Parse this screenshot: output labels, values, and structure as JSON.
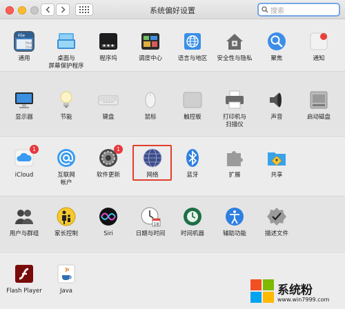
{
  "window": {
    "title": "系统偏好设置"
  },
  "search": {
    "placeholder": "搜索"
  },
  "rows": {
    "r1": [
      "通用",
      "桌面与\n屏幕保护程序",
      "程序坞",
      "调度中心",
      "语言与地区",
      "安全性与隐私",
      "聚焦",
      "通知"
    ],
    "r2": [
      "显示器",
      "节能",
      "键盘",
      "鼠标",
      "触控板",
      "打印机与\n扫描仪",
      "声音",
      "启动磁盘"
    ],
    "r3": [
      "iCloud",
      "互联网\n帐户",
      "软件更新",
      "网络",
      "蓝牙",
      "扩展",
      "共享"
    ],
    "r4": [
      "用户与群组",
      "家长控制",
      "Siri",
      "日期与时间",
      "时间机器",
      "辅助功能",
      "描述文件"
    ],
    "r5": [
      "Flash Player",
      "Java"
    ]
  },
  "badges": {
    "icloud": "1",
    "software_update": "1"
  },
  "general_icon_text": [
    "File",
    "New",
    "One"
  ],
  "calendar_day": "18",
  "watermark": {
    "text": "系统粉",
    "url": "www.win7999.com"
  }
}
